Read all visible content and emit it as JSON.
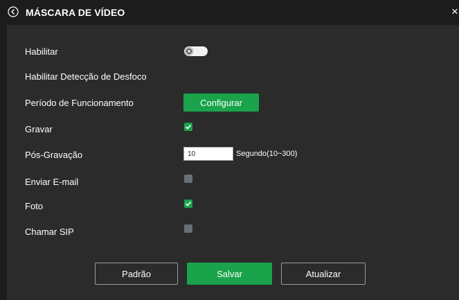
{
  "header": {
    "title": "MÁSCARA DE VÍDEO",
    "back_icon": "chevron-left-circle-icon",
    "close_icon": "close-icon",
    "close_glyph": "×"
  },
  "form": {
    "enable": {
      "label": "Habilitar",
      "state": "off"
    },
    "blur_detection": {
      "label": "Habilitar Detecção de Desfoco"
    },
    "schedule": {
      "label": "Período de Funcionamento",
      "button_label": "Configurar"
    },
    "record": {
      "label": "Gravar",
      "checked": true
    },
    "post_record": {
      "label": "Pós-Gravação",
      "value": "10",
      "unit_label": "Segundo(10~300)"
    },
    "send_email": {
      "label": "Enviar E-mail",
      "checked": false
    },
    "snapshot": {
      "label": "Foto",
      "checked": true
    },
    "sip_call": {
      "label": "Chamar SIP",
      "checked": false
    }
  },
  "footer": {
    "default_label": "Padrão",
    "save_label": "Salvar",
    "refresh_label": "Atualizar"
  },
  "colors": {
    "accent": "#1aa34b",
    "background": "#1c1c1c",
    "panel": "#2b2b2b",
    "checkbox_off": "#6a6f73"
  }
}
